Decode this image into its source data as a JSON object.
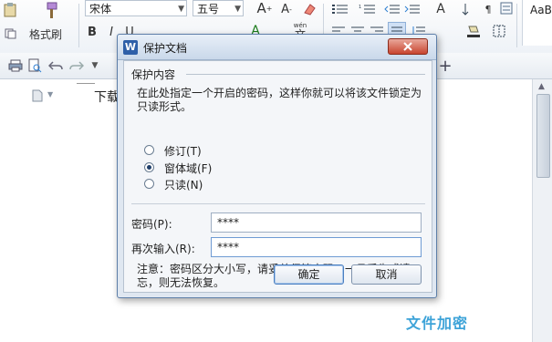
{
  "ribbon": {
    "format_painter_label": "格式刷",
    "font_name": "宋体",
    "font_size": "五号",
    "style_preview": "AaBb",
    "bold": "B",
    "italic": "I",
    "underline": "U",
    "grow_font": "A",
    "shrink_font": "A",
    "font_color": "A",
    "pinyin_top": "wén",
    "pinyin_char": "文",
    "plus": "+"
  },
  "document": {
    "partial_text": "下载"
  },
  "dialog": {
    "title": "保护文档",
    "group_label": "保护内容",
    "instruction": "在此处指定一个开启的密码，这样你就可以将该文件锁定为只读形式。",
    "options": [
      {
        "label": "修订(T)",
        "selected": false
      },
      {
        "label": "窗体域(F)",
        "selected": true
      },
      {
        "label": "只读(N)",
        "selected": false
      }
    ],
    "password_label": "密码(P):",
    "password_value": "****",
    "confirm_label": "再次输入(R):",
    "confirm_value": "****",
    "note": "注意：密码区分大小写，请妥善保管密码，一旦丢失或遗忘，则无法恢复。",
    "ok_label": "确定",
    "cancel_label": "取消"
  },
  "watermark": {
    "text": "文件加密"
  },
  "colors": {
    "accent": "#2e7fd1",
    "watermark": "#3da3d8",
    "dialog_border": "#5d7ea8"
  }
}
